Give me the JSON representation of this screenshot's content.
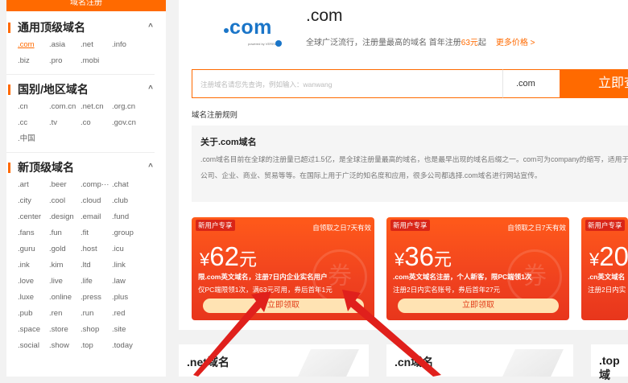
{
  "sidebar": {
    "title": "域名注册",
    "categories": [
      {
        "title": "通用顶级域名",
        "arrow": "^",
        "tlds": [
          ".com",
          ".asia",
          ".net",
          ".info",
          ".biz",
          ".pro",
          ".mobi"
        ]
      },
      {
        "title": "国别/地区域名",
        "arrow": "^",
        "tlds": [
          ".cn",
          ".com.cn",
          ".net.cn",
          ".org.cn",
          ".cc",
          ".tv",
          ".co",
          ".gov.cn",
          ".中国"
        ]
      },
      {
        "title": "新顶级域名",
        "arrow": "^",
        "tlds": [
          ".art",
          ".beer",
          ".comp···",
          ".chat",
          ".city",
          ".cool",
          ".cloud",
          ".club",
          ".center",
          ".design",
          ".email",
          ".fund",
          ".fans",
          ".fun",
          ".fit",
          ".group",
          ".guru",
          ".gold",
          ".host",
          ".icu",
          ".ink",
          ".kim",
          ".ltd",
          ".link",
          ".love",
          ".live",
          ".life",
          ".law",
          ".luxe",
          ".online",
          ".press",
          ".plus",
          ".pub",
          ".ren",
          ".run",
          ".red",
          ".space",
          ".store",
          ".shop",
          ".site",
          ".social",
          ".show",
          ".top",
          ".today"
        ]
      }
    ]
  },
  "domain": {
    "logo_text": "com",
    "logo_small": "powered by VERISIGN",
    "name": ".com",
    "desc_prefix": "全球广泛流行，注册量最高的域名   首年注册",
    "price": "63元",
    "desc_suffix": "起",
    "more_prices": "更多价格 >"
  },
  "search": {
    "placeholder": "注册域名请您先查询，例如输入：wanwang",
    "suffix": ".com",
    "button": "立即查询"
  },
  "rules_link": "域名注册规则",
  "about": {
    "title": "关于.com域名",
    "text": ".com域名目前在全球的注册量已超过1.5亿，是全球注册量最高的域名，也是最早出现的域名后缀之一。com可为company的缩写，适用于公司、企业、商业、贸易等等。在国际上用于广泛的知名度和应用，很多公司都选择.com域名进行网站宣传。"
  },
  "coupons": [
    {
      "tag": "新用户专享",
      "valid": "自领取之日7天有效",
      "currency": "¥",
      "amount": "62",
      "unit": "元",
      "line1": "限.com英文域名，注册7日内企业实名用户",
      "line2": "仅PC端限领1次，满63元可用，券后首年1元",
      "claim": "立即领取"
    },
    {
      "tag": "新用户专享",
      "valid": "自领取之日7天有效",
      "currency": "¥",
      "amount": "36",
      "unit": "元",
      "line1": ".com英文域名注册，个人新客，限PC端领1次",
      "line2": "注册2日内实名账号，券后首年27元",
      "claim": "立即领取"
    },
    {
      "tag": "新用户专享",
      "valid": "",
      "currency": "¥",
      "amount": "20",
      "unit": "",
      "line1": ".cn英文域名",
      "line2": "注册2日内实",
      "claim": ""
    }
  ],
  "bottom_cards": [
    ".net域名",
    ".cn域名",
    ".top域"
  ],
  "colors": {
    "accent": "#ff6a00",
    "com_blue": "#1a75c8",
    "arrow_red": "#e0201c"
  }
}
